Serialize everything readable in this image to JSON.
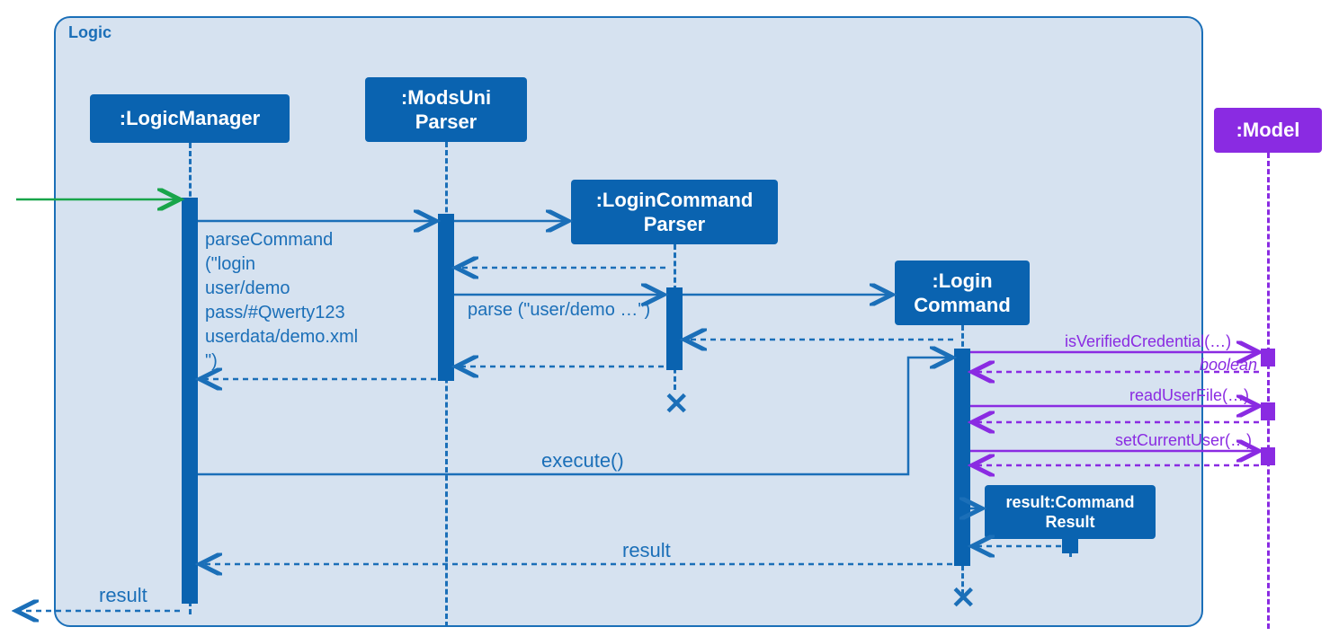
{
  "frame": {
    "label": "Logic"
  },
  "participants": {
    "logicManager": ":LogicManager",
    "modsUniParser": ":ModsUni\nParser",
    "loginCommandParser": ":LoginCommand\nParser",
    "loginCommand": ":Login\nCommand",
    "commandResult": "result:Command\nResult",
    "model": ":Model"
  },
  "messages": {
    "parseCommand": "parseCommand\n(\"login\nuser/demo\npass/#Qwerty123\nuserdata/demo.xml\n\")",
    "parse": "parse (\"user/demo …\")",
    "execute": "execute()",
    "resultMid": "result",
    "resultOut": "result",
    "isVerifiedCredential": "isVerifiedCredential(…)",
    "boolean": "boolean",
    "readUserFile": "readUserFile(…)",
    "setCurrentUser": "setCurrentUser(…)"
  },
  "colors": {
    "blue": "#0a63b0",
    "blueLine": "#1b6fb8",
    "purple": "#8a2be2",
    "green": "#18a54a",
    "frameFill": "#d6e2f0"
  }
}
